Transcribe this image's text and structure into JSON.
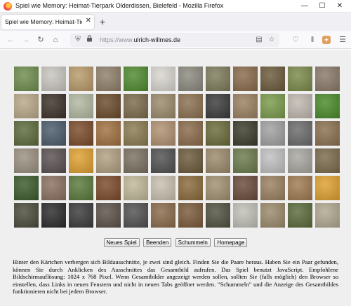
{
  "window": {
    "title": "Spiel wie Memory: Heimat-Tierpark Olderdissen, Bielefeld - Mozilla Firefox"
  },
  "tab": {
    "title": "Spiel wie Memory: Heimat-Tierpark"
  },
  "url": {
    "prefix": "https://www.",
    "domain": "ulrich-willmes.de"
  },
  "icons": {
    "minimize": "minimize-icon",
    "maximize": "maximize-icon",
    "close": "close-icon",
    "back": "back-arrow-icon",
    "forward": "forward-arrow-icon",
    "reload": "reload-icon",
    "home": "home-icon",
    "shield": "tracking-shield-icon",
    "lock": "lock-icon",
    "reader": "reader-view-icon",
    "bookmark": "bookmark-star-icon",
    "pocket": "pocket-icon",
    "library": "library-icon",
    "extension": "extension-icon",
    "menu": "hamburger-menu-icon"
  },
  "game": {
    "buttons": [
      {
        "label": "Neues Spiel"
      },
      {
        "label": "Beenden"
      },
      {
        "label": "Schummeln"
      },
      {
        "label": "Homepage"
      }
    ],
    "tiles": [
      "#6e8d4e",
      "#c9c6bf",
      "#b89a6a",
      "#8f7f6a",
      "#4f8a2e",
      "#d9d6cf",
      "#8c8a7e",
      "#7d7a5a",
      "#8a6a4a",
      "#6a5a3a",
      "#7a8a4a",
      "#8a7a6a",
      "#b8a888",
      "#3a3028",
      "#b0b8a0",
      "#6a4a2a",
      "#7a6a4a",
      "#9a8a6a",
      "#8a7050",
      "#3a3a3a",
      "#9a8060",
      "#7a9a4a",
      "#c0b8b0",
      "#4a8a2a",
      "#5a6a3a",
      "#4a5a6a",
      "#7a4a2a",
      "#a07040",
      "#8a7a50",
      "#b09070",
      "#8a6a4a",
      "#6a6a3a",
      "#3a3a2a",
      "#a0a0a0",
      "#6a6a6a",
      "#8a7050",
      "#9a9080",
      "#5a5050",
      "#e0a030",
      "#b0a080",
      "#7a7060",
      "#505050",
      "#6a5a3a",
      "#9a8a6a",
      "#6a7a4a",
      "#c0c0c0",
      "#a8a6a0",
      "#7a6a4a",
      "#3a5a2a",
      "#8a7060",
      "#5a7a3a",
      "#7a4a2a",
      "#c0b898",
      "#c8c0b0",
      "#8a6a3a",
      "#a09070",
      "#6a4a3a",
      "#9a8060",
      "#a07a50",
      "#e0a030",
      "#4a4a3a",
      "#2a2a2a",
      "#3a3a3a",
      "#5a5048",
      "#505050",
      "#8a6a4a",
      "#7a5a3a",
      "#505040",
      "#c0c0b8",
      "#9a8a6a",
      "#5a6a3a",
      "#b0a890"
    ]
  },
  "description": "Hinter den Kärtchen verbergen sich Bildausschnitte, je zwei sind gleich. Finden Sie die Paare heraus. Haben Sie ein Paar gefunden, können Sie durch Anklicken des Ausschnittes das Gesamtbild aufrufen. Das Spiel benutzt JavaScript. Empfohlene Bildschirmauflösung: 1024 x 768 Pixel. Wenn Gesamtbilder angezeigt werden sollen, sollten Sie (falls möglich) den Browser so einstellen, dass Links in neuen Fenstern und nicht in neuen Tabs geöffnet werden. \"Schummeln\" und die Anzeige des Gesamtbildes funktionieren nicht bei jedem Browser."
}
